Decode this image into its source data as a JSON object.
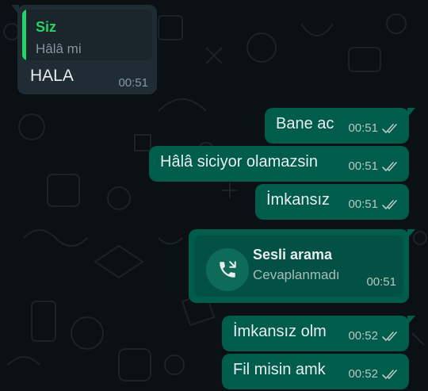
{
  "incoming": {
    "quote_author": "Siz",
    "quote_text": "Hâlâ mi",
    "text": "HALA",
    "time": "00:51"
  },
  "outgoing": [
    {
      "text": "Bane ac",
      "time": "00:51"
    },
    {
      "text": "Hâlâ siciyor olamazsin",
      "time": "00:51"
    },
    {
      "text": "İmkansız",
      "time": "00:51"
    }
  ],
  "call": {
    "title": "Sesli arama",
    "status": "Cevaplanmadı",
    "time": "00:51",
    "icon": "missed-call-icon"
  },
  "outgoing_after": [
    {
      "text": "İmkansız olm",
      "time": "00:52"
    },
    {
      "text": "Fil misin amk",
      "time": "00:52"
    }
  ],
  "colors": {
    "background": "#0b1014",
    "incoming_bubble": "#1f2c34",
    "outgoing_bubble": "#005c4b",
    "quote_accent": "#25d366",
    "read_ticks": "#b8c7c0"
  }
}
